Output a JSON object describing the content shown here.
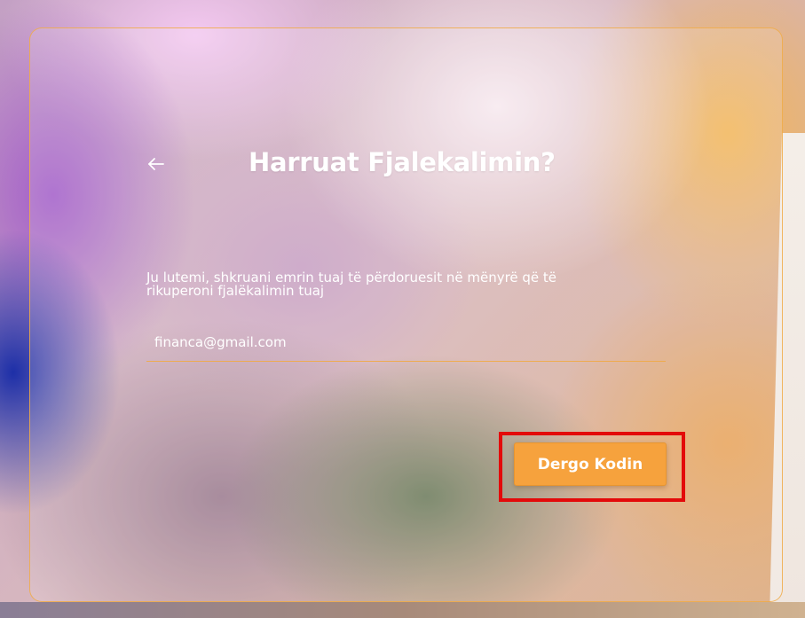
{
  "form": {
    "title": "Harruat Fjalekalimin?",
    "instructions_line1": "Ju lutemi, shkruani emrin tuaj të përdoruesit në mënyrë që të",
    "instructions_line2": "rikuperoni fjalëkalimin tuaj",
    "email_value": "financa@gmail.com",
    "submit_label": "Dergo Kodin"
  },
  "icons": {
    "back": "arrow-left-icon"
  },
  "colors": {
    "accent": "#f6a23d",
    "card_border": "#f0aa46",
    "highlight": "#e30a0a",
    "text": "#ffffff"
  }
}
